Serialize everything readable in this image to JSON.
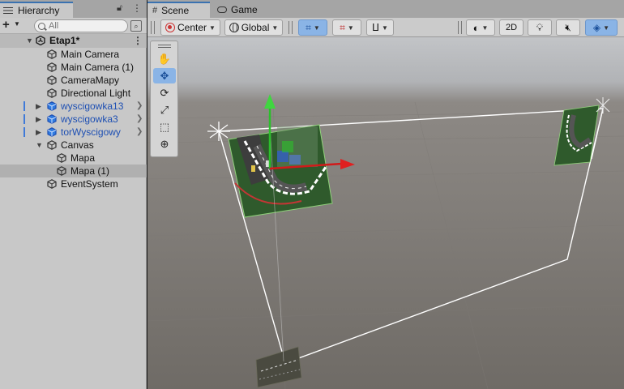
{
  "hierarchy": {
    "tab_label": "Hierarchy",
    "lock_icon": "lock-icon",
    "menu_icon": "kebab-menu-icon",
    "add_label": "+",
    "search_placeholder": "All",
    "scene": {
      "name": "Etap1*"
    },
    "items": [
      {
        "label": "Main Camera",
        "depth": 1,
        "prefab": false,
        "foldable": false
      },
      {
        "label": "Main Camera (1)",
        "depth": 1,
        "prefab": false,
        "foldable": false
      },
      {
        "label": "CameraMapy",
        "depth": 1,
        "prefab": false,
        "foldable": false
      },
      {
        "label": "Directional Light",
        "depth": 1,
        "prefab": false,
        "foldable": false
      },
      {
        "label": "wyscigowka13",
        "depth": 1,
        "prefab": true,
        "foldable": true
      },
      {
        "label": "wyscigowka3",
        "depth": 1,
        "prefab": true,
        "foldable": true
      },
      {
        "label": "torWyscigowy",
        "depth": 1,
        "prefab": true,
        "foldable": true
      },
      {
        "label": "Canvas",
        "depth": 1,
        "prefab": false,
        "foldable": true,
        "expanded": true
      },
      {
        "label": "Mapa",
        "depth": 2,
        "prefab": false,
        "foldable": false
      },
      {
        "label": "Mapa (1)",
        "depth": 2,
        "prefab": false,
        "foldable": false,
        "selected": true
      },
      {
        "label": "EventSystem",
        "depth": 1,
        "prefab": false,
        "foldable": false
      }
    ]
  },
  "scene_view": {
    "tabs": [
      {
        "label": "Scene",
        "icon": "grid-hash-icon",
        "active": true
      },
      {
        "label": "Game",
        "icon": "gamepad-icon",
        "active": false
      }
    ],
    "toolbar": {
      "pivot_label": "Center",
      "space_label": "Global",
      "mode_2d_label": "2D"
    },
    "tools": [
      {
        "name": "hand-tool",
        "glyph": "✋",
        "active": false
      },
      {
        "name": "move-tool",
        "glyph": "✥",
        "active": true
      },
      {
        "name": "rotate-tool",
        "glyph": "⟳",
        "active": false
      },
      {
        "name": "scale-tool",
        "glyph": "⤢",
        "active": false
      },
      {
        "name": "rect-tool",
        "glyph": "⬚",
        "active": false
      },
      {
        "name": "transform-tool",
        "glyph": "⊕",
        "active": false
      }
    ]
  },
  "colors": {
    "accent": "#3a72b0",
    "active_button": "#8ab4e6",
    "prefab_text": "#1d4fb3",
    "gizmo_x": "#d11a1a",
    "gizmo_y": "#2bbf2b",
    "gizmo_z": "#2e5bd6"
  }
}
